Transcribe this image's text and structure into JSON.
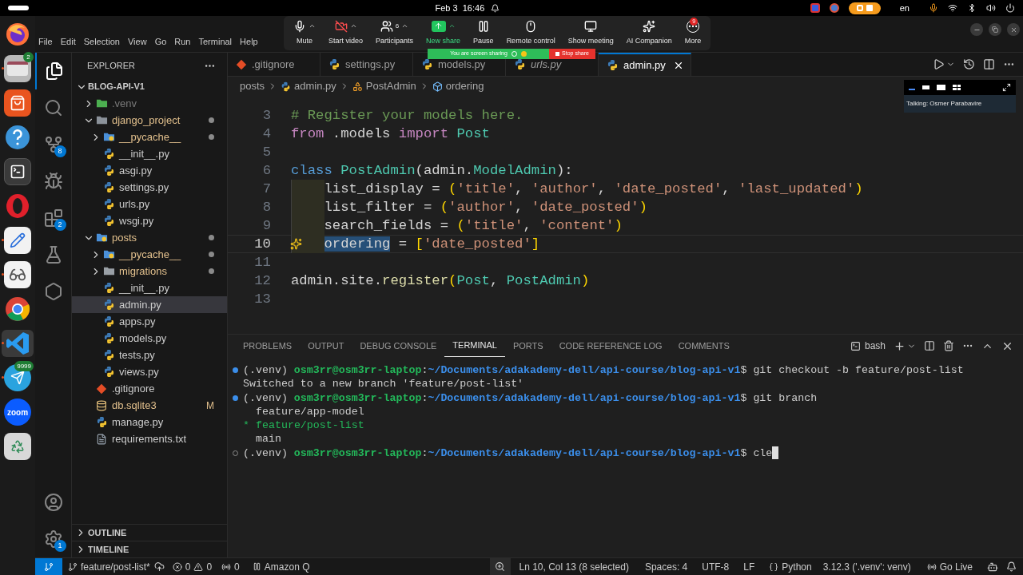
{
  "system_bar": {
    "date": "Feb 3",
    "time": "16:46",
    "language": "en"
  },
  "dock": [
    {
      "kind": "firefox",
      "running": false,
      "selected": false
    },
    {
      "kind": "files",
      "badge": "2",
      "running": true,
      "selected": false
    },
    {
      "kind": "app-center",
      "running": false,
      "selected": false
    },
    {
      "kind": "help",
      "running": false,
      "selected": false
    },
    {
      "kind": "terminal",
      "running": false,
      "selected": false
    },
    {
      "kind": "opera",
      "running": false,
      "selected": false
    },
    {
      "kind": "text-editor",
      "running": true,
      "selected": false
    },
    {
      "kind": "document-viewer",
      "running": true,
      "selected": false
    },
    {
      "kind": "chrome",
      "running": false,
      "selected": false
    },
    {
      "kind": "vscode",
      "running": true,
      "selected": true
    },
    {
      "kind": "telegram",
      "badge": "9999",
      "running": true,
      "selected": false
    },
    {
      "kind": "zoom",
      "label": "zoom",
      "running": false,
      "selected": false
    },
    {
      "kind": "trash",
      "running": false,
      "selected": false
    }
  ],
  "menu": [
    "File",
    "Edit",
    "Selection",
    "View",
    "Go",
    "Run",
    "Terminal",
    "Help"
  ],
  "meeting_toolbar": [
    {
      "kind": "mic",
      "label": "Mute",
      "caret": true
    },
    {
      "kind": "video-off",
      "label": "Start video",
      "caret": true
    },
    {
      "kind": "participants",
      "label": "Participants",
      "count": "6",
      "caret": true
    },
    {
      "kind": "share",
      "label": "New share",
      "caret": true
    },
    {
      "kind": "pause",
      "label": "Pause",
      "caret": false
    },
    {
      "kind": "remote",
      "label": "Remote control",
      "caret": false
    },
    {
      "kind": "meeting",
      "label": "Show meeting",
      "caret": false
    },
    {
      "kind": "ai",
      "label": "AI Companion",
      "caret": false
    },
    {
      "kind": "more",
      "label": "More",
      "badge": "9",
      "caret": false
    }
  ],
  "share_banner": {
    "text": "You are screen sharing",
    "stop": "Stop share"
  },
  "speaker_view": {
    "text": "Talking: Osmer Parabavire"
  },
  "activity_bar": {
    "top": [
      {
        "kind": "explorer",
        "selected": true
      },
      {
        "kind": "search",
        "selected": false
      },
      {
        "kind": "source-control",
        "badge": "8",
        "selected": false
      },
      {
        "kind": "run",
        "selected": false
      },
      {
        "kind": "extensions",
        "badge": "2",
        "selected": false
      },
      {
        "kind": "testing",
        "selected": false
      },
      {
        "kind": "remote",
        "selected": false
      }
    ],
    "bottom": [
      {
        "kind": "account"
      },
      {
        "kind": "settings",
        "badge": "1"
      }
    ]
  },
  "explorer": {
    "title": "EXPLORER",
    "tree": [
      {
        "label": "BLOG-API-V1",
        "kind": "root",
        "selected": false,
        "expanded": true,
        "children": [
          {
            "label": ".venv",
            "kind": "folder-venv",
            "ignored": true,
            "modified": false,
            "selected": false,
            "expanded": false
          },
          {
            "label": "django_project",
            "kind": "folder",
            "ignored": false,
            "modified": true,
            "selected": false,
            "expanded": true,
            "children": [
              {
                "label": "__pycache__",
                "kind": "folder-python",
                "ignored": false,
                "modified": true,
                "selected": false,
                "expanded": false
              },
              {
                "label": "__init__.py",
                "kind": "python",
                "ignored": false,
                "modified": false,
                "selected": false
              },
              {
                "label": "asgi.py",
                "kind": "python",
                "ignored": false,
                "modified": false,
                "selected": false
              },
              {
                "label": "settings.py",
                "kind": "python",
                "ignored": false,
                "modified": false,
                "selected": false
              },
              {
                "label": "urls.py",
                "kind": "python",
                "ignored": false,
                "modified": false,
                "selected": false
              },
              {
                "label": "wsgi.py",
                "kind": "python",
                "ignored": false,
                "modified": false,
                "selected": false
              }
            ]
          },
          {
            "label": "posts",
            "kind": "folder-python",
            "ignored": false,
            "modified": true,
            "selected": false,
            "expanded": true,
            "children": [
              {
                "label": "__pycache__",
                "kind": "folder-python",
                "ignored": false,
                "modified": true,
                "selected": false,
                "expanded": false
              },
              {
                "label": "migrations",
                "kind": "folder",
                "ignored": false,
                "modified": true,
                "selected": false,
                "expanded": false
              },
              {
                "label": "__init__.py",
                "kind": "python",
                "ignored": false,
                "modified": false,
                "selected": false
              },
              {
                "label": "admin.py",
                "kind": "python",
                "ignored": false,
                "modified": false,
                "selected": true
              },
              {
                "label": "apps.py",
                "kind": "python",
                "ignored": false,
                "modified": false,
                "selected": false
              },
              {
                "label": "models.py",
                "kind": "python",
                "ignored": false,
                "modified": false,
                "selected": false
              },
              {
                "label": "tests.py",
                "kind": "python",
                "ignored": false,
                "modified": false,
                "selected": false
              },
              {
                "label": "views.py",
                "kind": "python",
                "ignored": false,
                "modified": false,
                "selected": false
              }
            ]
          },
          {
            "label": ".gitignore",
            "kind": "git",
            "ignored": false,
            "modified": false,
            "selected": false
          },
          {
            "label": "db.sqlite3",
            "kind": "database",
            "ignored": false,
            "modified": true,
            "badge": "M",
            "selected": false
          },
          {
            "label": "manage.py",
            "kind": "python",
            "ignored": false,
            "modified": false,
            "selected": false
          },
          {
            "label": "requirements.txt",
            "kind": "text",
            "ignored": false,
            "modified": false,
            "selected": false
          }
        ]
      }
    ],
    "sections": [
      {
        "label": "OUTLINE",
        "expanded": false
      },
      {
        "label": "TIMELINE",
        "expanded": false
      }
    ]
  },
  "tabs": [
    {
      "label": ".gitignore",
      "kind": "git",
      "selected": false,
      "preview": false
    },
    {
      "label": "settings.py",
      "kind": "python",
      "selected": false,
      "preview": false
    },
    {
      "label": "models.py",
      "kind": "python",
      "selected": false,
      "preview": false
    },
    {
      "label": "urls.py",
      "kind": "python",
      "selected": false,
      "preview": true
    },
    {
      "label": "admin.py",
      "kind": "python",
      "selected": true,
      "preview": false
    }
  ],
  "breadcrumbs": [
    {
      "label": "posts",
      "kind": "folder"
    },
    {
      "label": "admin.py",
      "kind": "python"
    },
    {
      "label": "PostAdmin",
      "kind": "class"
    },
    {
      "label": "ordering",
      "kind": "field"
    }
  ],
  "code": [
    {
      "number": "3",
      "current": false,
      "indented": false,
      "tokens": [
        {
          "text": "# Register your models here.",
          "kind": "comment"
        }
      ]
    },
    {
      "number": "4",
      "current": false,
      "indented": false,
      "tokens": [
        {
          "text": "from",
          "kind": "control"
        },
        {
          "text": " .models ",
          "kind": "plain"
        },
        {
          "text": "import",
          "kind": "control"
        },
        {
          "text": " Post",
          "kind": "class"
        }
      ]
    },
    {
      "number": "5",
      "current": false,
      "indented": false
    },
    {
      "number": "6",
      "current": false,
      "indented": false,
      "tokens": [
        {
          "text": "class",
          "kind": "keyword"
        },
        {
          "text": " PostAdmin",
          "kind": "class"
        },
        {
          "text": "(admin.",
          "kind": "plain"
        },
        {
          "text": "ModelAdmin",
          "kind": "class"
        },
        {
          "text": "):",
          "kind": "plain"
        }
      ]
    },
    {
      "number": "7",
      "current": false,
      "indented": true,
      "tokens": [
        {
          "text": "list_display = ",
          "kind": "plain"
        },
        {
          "text": "(",
          "kind": "paren"
        },
        {
          "text": "'title'",
          "kind": "string"
        },
        {
          "text": ", ",
          "kind": "plain"
        },
        {
          "text": "'author'",
          "kind": "string"
        },
        {
          "text": ", ",
          "kind": "plain"
        },
        {
          "text": "'date_posted'",
          "kind": "string"
        },
        {
          "text": ", ",
          "kind": "plain"
        },
        {
          "text": "'last_updated'",
          "kind": "string"
        },
        {
          "text": ")",
          "kind": "paren"
        }
      ]
    },
    {
      "number": "8",
      "current": false,
      "indented": true,
      "tokens": [
        {
          "text": "list_filter = ",
          "kind": "plain"
        },
        {
          "text": "(",
          "kind": "paren"
        },
        {
          "text": "'author'",
          "kind": "string"
        },
        {
          "text": ", ",
          "kind": "plain"
        },
        {
          "text": "'date_posted'",
          "kind": "string"
        },
        {
          "text": ")",
          "kind": "paren"
        }
      ]
    },
    {
      "number": "9",
      "current": false,
      "indented": true,
      "tokens": [
        {
          "text": "search_fields = ",
          "kind": "plain"
        },
        {
          "text": "(",
          "kind": "paren"
        },
        {
          "text": "'title'",
          "kind": "string"
        },
        {
          "text": ", ",
          "kind": "plain"
        },
        {
          "text": "'content'",
          "kind": "string"
        },
        {
          "text": ")",
          "kind": "paren"
        }
      ]
    },
    {
      "number": "10",
      "current": true,
      "indented": true,
      "tokens": [
        {
          "text": "ordering",
          "kind": "selection"
        },
        {
          "text": " = ",
          "kind": "plain"
        },
        {
          "text": "[",
          "kind": "paren"
        },
        {
          "text": "'date_posted'",
          "kind": "string"
        },
        {
          "text": "]",
          "kind": "paren"
        }
      ]
    },
    {
      "number": "11",
      "current": false,
      "indented": false
    },
    {
      "number": "12",
      "current": false,
      "indented": false,
      "tokens": [
        {
          "text": "admin.site.",
          "kind": "plain"
        },
        {
          "text": "register",
          "kind": "func"
        },
        {
          "text": "(",
          "kind": "paren"
        },
        {
          "text": "Post",
          "kind": "class"
        },
        {
          "text": ", ",
          "kind": "plain"
        },
        {
          "text": "PostAdmin",
          "kind": "class"
        },
        {
          "text": ")",
          "kind": "paren"
        }
      ]
    },
    {
      "number": "13",
      "current": false,
      "indented": false
    }
  ],
  "panel": {
    "tabs": [
      {
        "label": "PROBLEMS",
        "selected": false
      },
      {
        "label": "OUTPUT",
        "selected": false
      },
      {
        "label": "DEBUG CONSOLE",
        "selected": false
      },
      {
        "label": "TERMINAL",
        "selected": true
      },
      {
        "label": "PORTS",
        "selected": false
      },
      {
        "label": "CODE REFERENCE LOG",
        "selected": false
      },
      {
        "label": "COMMENTS",
        "selected": false
      }
    ],
    "shell": "bash",
    "terminal": [
      {
        "kind": "prompt",
        "done": true,
        "env": "(.venv)",
        "user_host": "osm3rr@osm3rr-laptop",
        "separator": ":",
        "path": "~/Documents/adakademy-dell/api-course/blog-api-v1",
        "symbol": "$",
        "command": "git checkout -b feature/post-list",
        "cursor": false
      },
      {
        "kind": "output",
        "text": "Switched to a new branch 'feature/post-list'"
      },
      {
        "kind": "prompt",
        "done": true,
        "env": "(.venv)",
        "user_host": "osm3rr@osm3rr-laptop",
        "separator": ":",
        "path": "~/Documents/adakademy-dell/api-course/blog-api-v1",
        "symbol": "$",
        "command": "git branch",
        "cursor": false
      },
      {
        "kind": "branch",
        "text": "feature/app-model",
        "current": false
      },
      {
        "kind": "branch",
        "marker": "*",
        "text": "feature/post-list",
        "current": true
      },
      {
        "kind": "branch",
        "text": "main",
        "current": false
      },
      {
        "kind": "prompt",
        "done": false,
        "env": "(.venv)",
        "user_host": "osm3rr@osm3rr-laptop",
        "separator": ":",
        "path": "~/Documents/adakademy-dell/api-course/blog-api-v1",
        "symbol": "$",
        "command": "cle",
        "cursor": true
      }
    ]
  },
  "status_bar": {
    "branch": "feature/post-list*",
    "errors": "0",
    "warnings": "0",
    "ports": "0",
    "amazon_q": "Amazon Q",
    "position": "Ln 10, Col 13 (8 selected)",
    "spaces": "Spaces: 4",
    "encoding": "UTF-8",
    "eol": "LF",
    "language": "Python",
    "interpreter": "3.12.3 ('.venv': venv)",
    "live": "Go Live"
  }
}
